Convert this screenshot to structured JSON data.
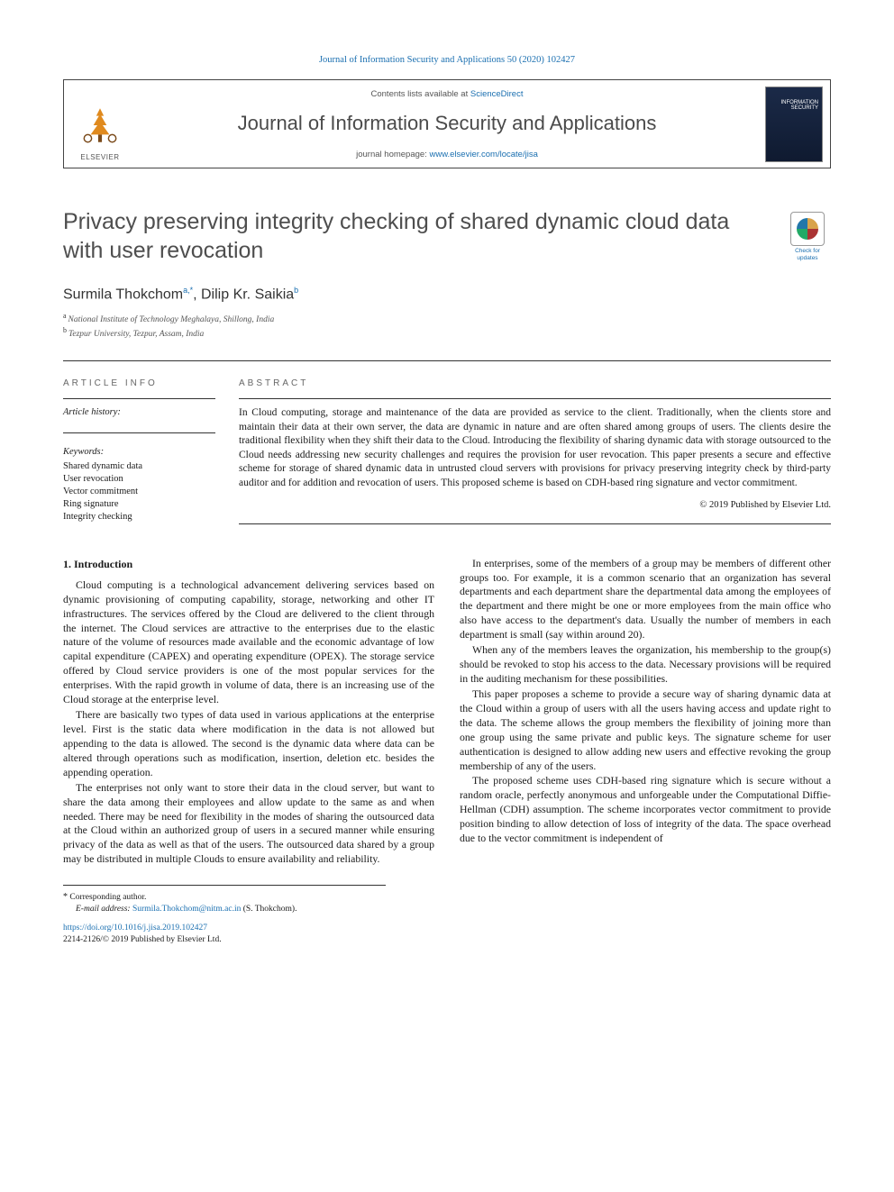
{
  "citation": "Journal of Information Security and Applications 50 (2020) 102427",
  "header": {
    "contents_prefix": "Contents lists available at ",
    "contents_link": "ScienceDirect",
    "journal_title": "Journal of Information Security and Applications",
    "homepage_prefix": "journal homepage: ",
    "homepage_url": "www.elsevier.com/locate/jisa",
    "publisher_name": "ELSEVIER",
    "cover_line1": "INFORMATION",
    "cover_line2": "SECURITY"
  },
  "updates_badge": "Check for updates",
  "article": {
    "title": "Privacy preserving integrity checking of shared dynamic cloud data with user revocation",
    "authors_html_parts": {
      "a1_name": "Surmila Thokchom",
      "a1_sup": "a,*",
      "sep": ", ",
      "a2_name": "Dilip Kr. Saikia",
      "a2_sup": "b"
    },
    "affiliations": [
      {
        "sup": "a",
        "text": "National Institute of Technology Meghalaya, Shillong, India"
      },
      {
        "sup": "b",
        "text": "Tezpur University, Tezpur, Assam, India"
      }
    ]
  },
  "info": {
    "label": "article info",
    "history_label": "Article history:",
    "keywords_label": "Keywords:",
    "keywords": [
      "Shared dynamic data",
      "User revocation",
      "Vector commitment",
      "Ring signature",
      "Integrity checking"
    ]
  },
  "abstract": {
    "label": "abstract",
    "text": "In Cloud computing, storage and maintenance of the data are provided as service to the client. Traditionally, when the clients store and maintain their data at their own server, the data are dynamic in nature and are often shared among groups of users. The clients desire the traditional flexibility when they shift their data to the Cloud. Introducing the flexibility of sharing dynamic data with storage outsourced to the Cloud needs addressing new security challenges and requires the provision for user revocation. This paper presents a secure and effective scheme for storage of shared dynamic data in untrusted cloud servers with provisions for privacy preserving integrity check by third-party auditor and for addition and revocation of users. This proposed scheme is based on CDH-based ring signature and vector commitment.",
    "copyright": "© 2019 Published by Elsevier Ltd."
  },
  "body": {
    "section_heading": "1. Introduction",
    "paragraphs": [
      "Cloud computing is a technological advancement delivering services based on dynamic provisioning of computing capability, storage, networking and other IT infrastructures. The services offered by the Cloud are delivered to the client through the internet. The Cloud services are attractive to the enterprises due to the elastic nature of the volume of resources made available and the economic advantage of low capital expenditure (CAPEX) and operating expenditure (OPEX). The storage service offered by Cloud service providers is one of the most popular services for the enterprises. With the rapid growth in volume of data, there is an increasing use of the Cloud storage at the enterprise level.",
      "There are basically two types of data used in various applications at the enterprise level. First is the static data where modification in the data is not allowed but appending to the data is allowed. The second is the dynamic data where data can be altered through operations such as modification, insertion, deletion etc. besides the appending operation.",
      "The enterprises not only want to store their data in the cloud server, but want to share the data among their employees and allow update to the same as and when needed. There may be need for flexibility in the modes of sharing the outsourced data at the Cloud within an authorized group of users in a secured manner while ensuring privacy of the data as well as that of the users. The outsourced data shared by a group may be distributed in multiple Clouds to ensure availability and reliability.",
      "In enterprises, some of the members of a group may be members of different other groups too. For example, it is a common scenario that an organization has several departments and each department share the departmental data among the employees of the department and there might be one or more employees from the main office who also have access to the department's data. Usually the number of members in each department is small (say within around 20).",
      "When any of the members leaves the organization, his membership to the group(s) should be revoked to stop his access to the data. Necessary provisions will be required in the auditing mechanism for these possibilities.",
      "This paper proposes a scheme to provide a secure way of sharing dynamic data at the Cloud within a group of users with all the users having access and update right to the data. The scheme allows the group members the flexibility of joining more than one group using the same private and public keys. The signature scheme for user authentication is designed to allow adding new users and effective revoking the group membership of any of the users.",
      "The proposed scheme uses CDH-based ring signature which is secure without a random oracle, perfectly anonymous and unforgeable under the Computational Diffie- Hellman (CDH) assumption. The scheme incorporates vector commitment to provide position binding to allow detection of loss of integrity of the data. The space overhead due to the vector commitment is independent of"
    ]
  },
  "footnote": {
    "corresponding": "Corresponding author.",
    "email_label": "E-mail address:",
    "email": "Surmila.Thokchom@nitm.ac.in",
    "email_person": "(S. Thokchom)."
  },
  "bottom": {
    "doi": "https://doi.org/10.1016/j.jisa.2019.102427",
    "issn_line": "2214-2126/© 2019 Published by Elsevier Ltd."
  }
}
